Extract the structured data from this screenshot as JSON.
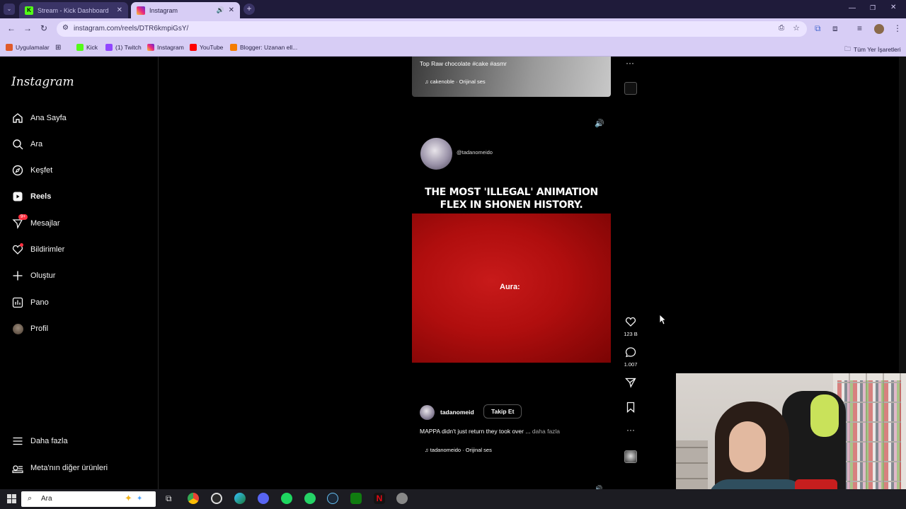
{
  "browser": {
    "tabs": [
      {
        "title": "Stream - Kick Dashboard",
        "active": false
      },
      {
        "title": "Instagram",
        "active": true
      }
    ],
    "url": "instagram.com/reels/DTR6kmpiGsY/",
    "bookmarks": [
      "Uygulamalar",
      "Kick",
      "(1) Twitch",
      "Instagram",
      "YouTube",
      "Blogger: Uzanan ell..."
    ],
    "all_bookmarks": "Tüm Yer İşaretleri"
  },
  "instagram": {
    "logo": "Instagram",
    "nav": [
      {
        "label": "Ana Sayfa",
        "icon": "home-icon"
      },
      {
        "label": "Ara",
        "icon": "search-icon"
      },
      {
        "label": "Keşfet",
        "icon": "compass-icon"
      },
      {
        "label": "Reels",
        "icon": "reels-icon",
        "active": true
      },
      {
        "label": "Mesajlar",
        "icon": "messenger-icon",
        "badge": "9+"
      },
      {
        "label": "Bildirimler",
        "icon": "heart-icon"
      },
      {
        "label": "Oluştur",
        "icon": "plus-icon"
      },
      {
        "label": "Pano",
        "icon": "chart-icon"
      },
      {
        "label": "Profil",
        "icon": "avatar-icon"
      }
    ],
    "more": "Daha fazla",
    "meta": "Meta'nın diğer ürünleri"
  },
  "prev_reel": {
    "caption_text": "Top Raw chocolate",
    "hashtags": "#cake #asmr",
    "audio": "cakenoble · Orijinal ses"
  },
  "reel": {
    "overlay_handle": "@tadanomeido",
    "headline": "THE MOST 'ILLEGAL' ANIMATION FLEX IN SHONEN HISTORY.",
    "video_text": "Aura:",
    "username": "tadanomeid",
    "follow_label": "Takip Et",
    "caption": "MAPPA didn't just return they took over ...",
    "more_label": "daha fazla",
    "audio": "tadanomeido · Orijinal ses",
    "likes": "123 B",
    "comments": "1.007"
  },
  "taskbar": {
    "search_placeholder": "Ara"
  }
}
